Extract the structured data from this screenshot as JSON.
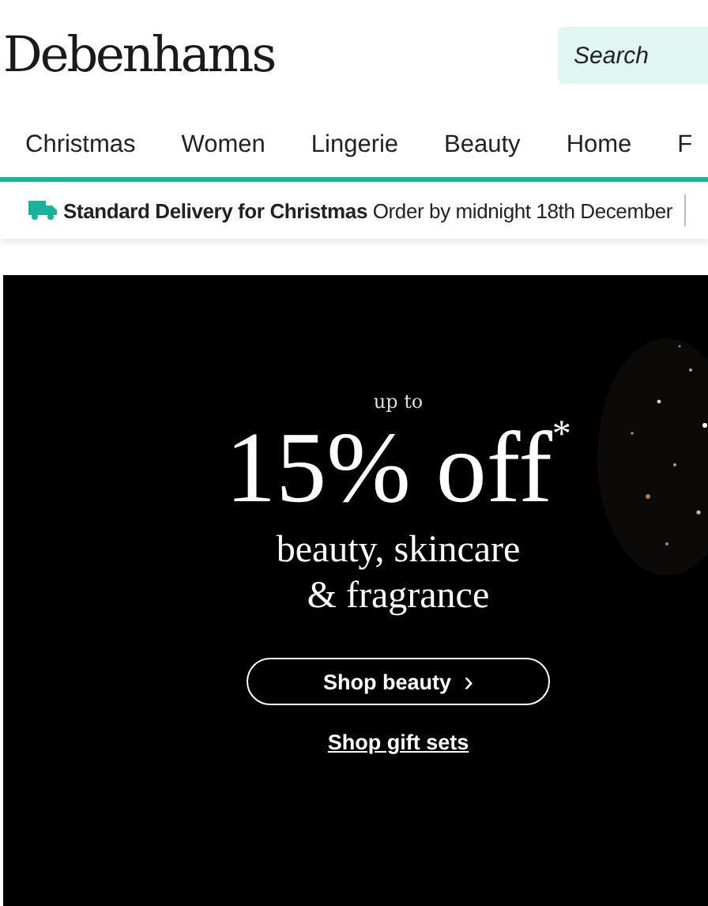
{
  "header": {
    "logo": "Debenhams",
    "search": {
      "placeholder": "Search"
    }
  },
  "nav": {
    "items": [
      {
        "label": "Christmas"
      },
      {
        "label": "Women"
      },
      {
        "label": "Lingerie"
      },
      {
        "label": "Beauty"
      },
      {
        "label": "Home"
      },
      {
        "label": "F"
      }
    ]
  },
  "delivery_bar": {
    "message": "**Standard Delivery for Christmas** Order by midnight 18th December"
  },
  "hero": {
    "kind": "picture",
    "eyebrow": "up to",
    "headline": "15% off$^{*}$",
    "subline": "beauty, skincare & fragrance",
    "button": "Shop beauty",
    "chevron": "›",
    "link": "Shop gift sets"
  }
}
